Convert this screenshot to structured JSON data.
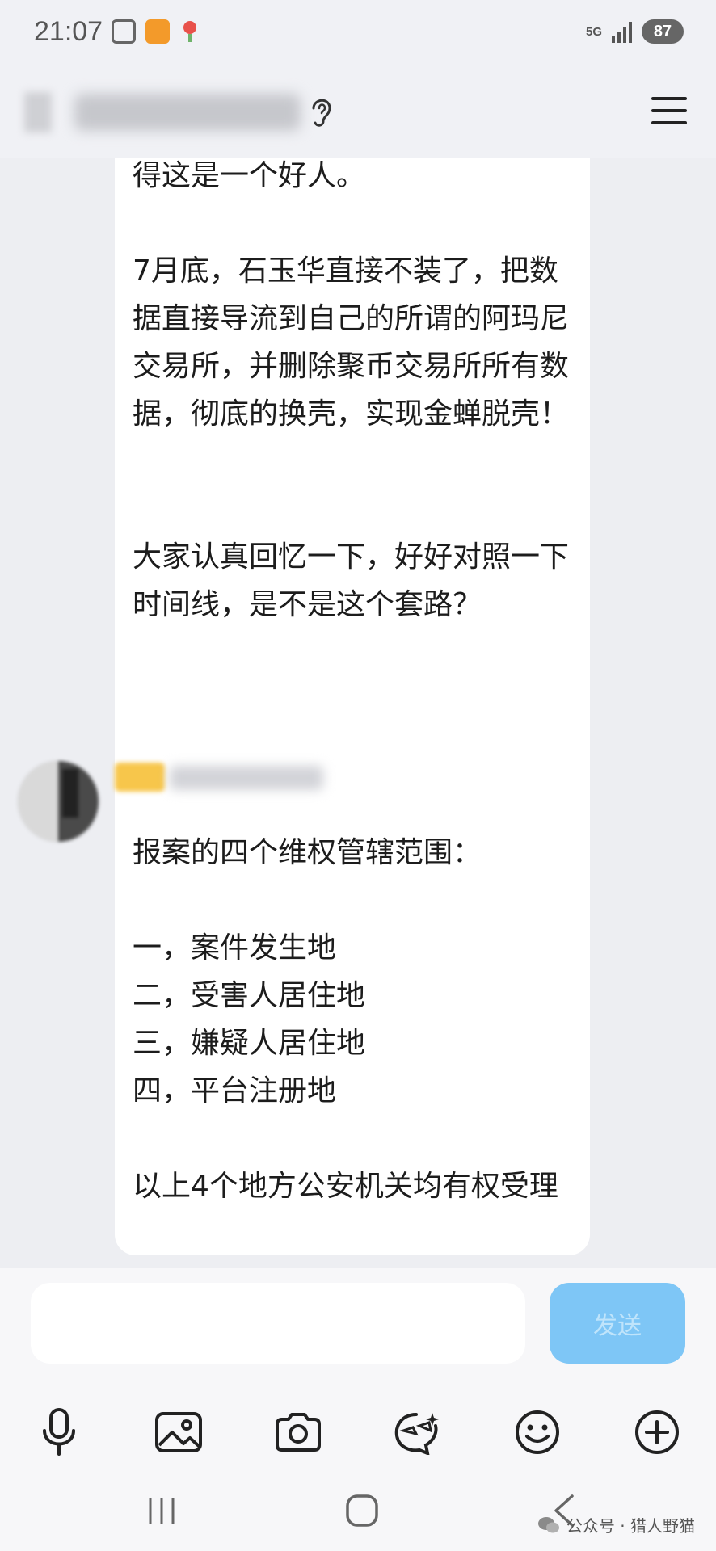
{
  "status_bar": {
    "time": "21:07",
    "network": "5G",
    "battery": "87"
  },
  "messages": [
    {
      "id": 1,
      "text": "得这是一个好人。\n\n7月底，石玉华直接不装了，把数据直接导流到自己的所谓的阿玛尼交易所，并删除聚币交易所所有数据，彻底的换壳，实现金蝉脱壳！\n\n\n大家认真回忆一下，好好对照一下时间线，是不是这个套路？"
    },
    {
      "id": 2,
      "text": "报案的四个维权管辖范围：\n\n一，案件发生地\n二，受害人居住地\n三，嫌疑人居住地\n四，平台注册地\n\n以上4个地方公安机关均有权受理"
    }
  ],
  "composer": {
    "input_value": "",
    "send_label": "发送"
  },
  "toolbar_icons": [
    "microphone-icon",
    "image-icon",
    "camera-icon",
    "sticker-icon",
    "emoji-icon",
    "plus-icon"
  ],
  "watermark": {
    "text": "公众号 · 猎人野猫"
  },
  "colors": {
    "background": "#edeef2",
    "bubble": "#ffffff",
    "send_button": "#7ec6f6",
    "scroll_button": "#8e97b3"
  }
}
